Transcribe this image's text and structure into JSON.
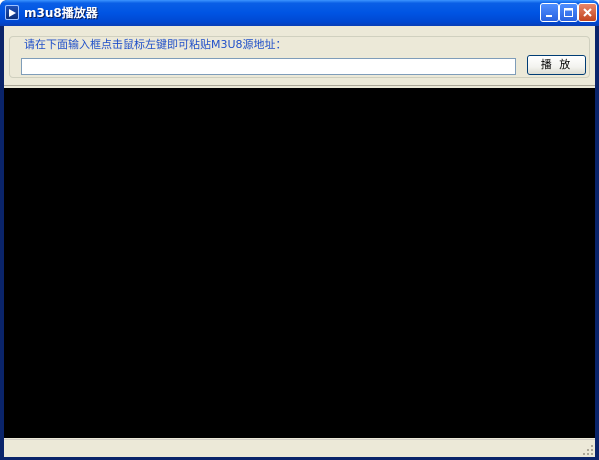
{
  "window": {
    "title": "m3u8播放器",
    "icon": "media-player-icon",
    "controls": [
      "minimize-icon",
      "maximize-icon",
      "close-icon"
    ],
    "title_bar_color": "#0054e3",
    "frame_color": "#0a246a"
  },
  "url_group": {
    "label": "请在下面输入框点击鼠标左键即可粘贴M3U8源地址：",
    "input_value": "",
    "input_placeholder": ""
  },
  "play_button": {
    "label": "播 放"
  },
  "video": {
    "background": "#000000"
  },
  "colors": {
    "client_bg": "#ece9d8",
    "group_label": "#1f4fc9"
  }
}
